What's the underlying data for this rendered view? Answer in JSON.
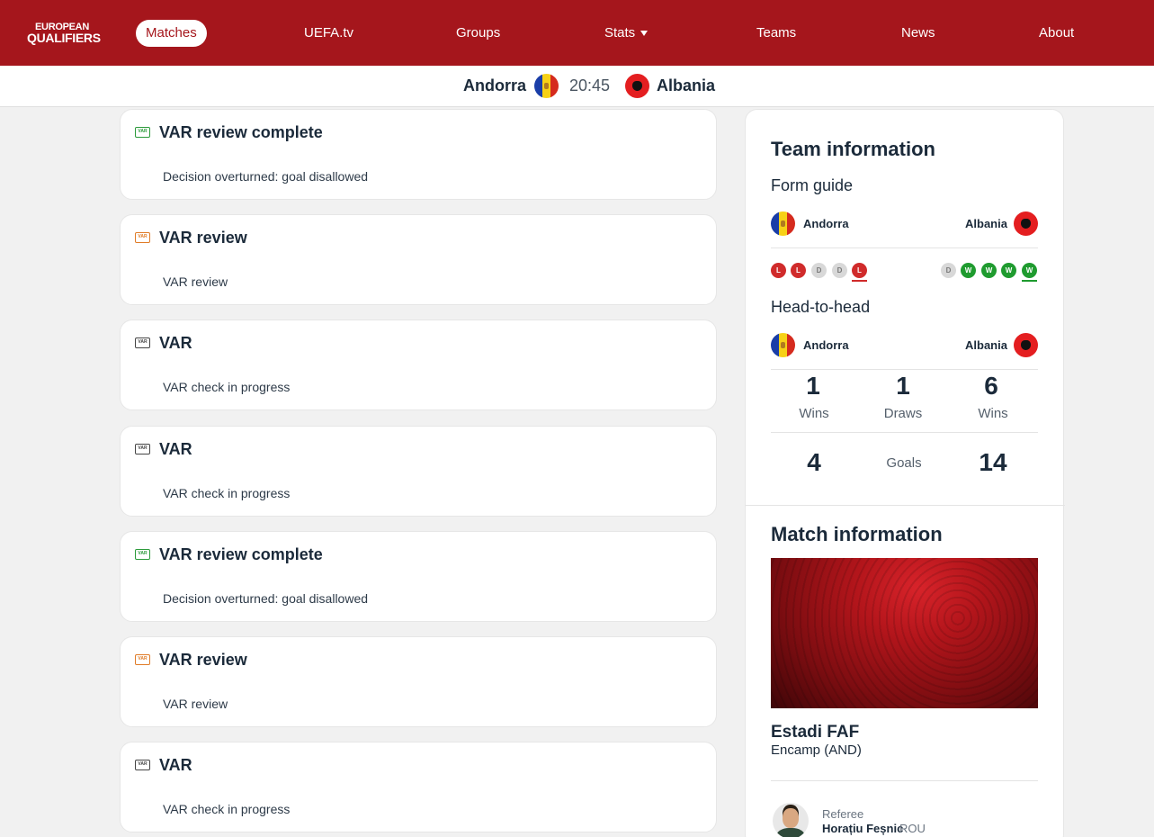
{
  "nav": {
    "logo_line1": "EUROPEAN",
    "logo_line2": "QUALIFIERS",
    "items": [
      {
        "label": "Matches",
        "active": true
      },
      {
        "label": "UEFA.tv"
      },
      {
        "label": "Groups"
      },
      {
        "label": "Stats"
      },
      {
        "label": "Teams"
      },
      {
        "label": "News"
      },
      {
        "label": "About"
      }
    ]
  },
  "scorebar": {
    "home": "Andorra",
    "time": "20:45",
    "away": "Albania"
  },
  "feed": [
    {
      "icon": "var-complete-icon",
      "color": "#2b9a3a",
      "title": "VAR review complete",
      "text": "Decision overturned: goal disallowed"
    },
    {
      "icon": "var-review-icon",
      "color": "#e07b26",
      "title": "VAR review",
      "text": "VAR review"
    },
    {
      "icon": "var-check-icon",
      "color": "#444444",
      "title": "VAR",
      "text": "VAR check in progress"
    },
    {
      "icon": "var-check-icon",
      "color": "#444444",
      "title": "VAR",
      "text": "VAR check in progress"
    },
    {
      "icon": "var-complete-icon",
      "color": "#2b9a3a",
      "title": "VAR review complete",
      "text": "Decision overturned: goal disallowed"
    },
    {
      "icon": "var-review-icon",
      "color": "#e07b26",
      "title": "VAR review",
      "text": "VAR review"
    },
    {
      "icon": "var-check-icon",
      "color": "#444444",
      "title": "VAR",
      "text": "VAR check in progress"
    }
  ],
  "var_icon_text": "VAR",
  "team_info": {
    "title": "Team information",
    "form_guide": {
      "title": "Form guide",
      "home": "Andorra",
      "away": "Albania",
      "home_form": [
        "L",
        "L",
        "D",
        "D",
        "L"
      ],
      "away_form": [
        "D",
        "W",
        "W",
        "W",
        "W"
      ]
    },
    "head_to_head": {
      "title": "Head-to-head",
      "home": "Andorra",
      "away": "Albania",
      "home_wins": "1",
      "home_wins_label": "Wins",
      "draws": "1",
      "draws_label": "Draws",
      "away_wins": "6",
      "away_wins_label": "Wins",
      "home_goals": "4",
      "goals_label": "Goals",
      "away_goals": "14"
    }
  },
  "match_info": {
    "title": "Match information",
    "venue": "Estadi FAF",
    "city": "Encamp (AND)",
    "referee_role": "Referee",
    "referee_name": "Horațiu Feșnic",
    "referee_nat": "ROU"
  },
  "colors": {
    "brand_red": "#a5161c",
    "win_green": "#1f9b2f",
    "loss_red": "#d02b2b",
    "draw_grey": "#d8d8d8"
  }
}
